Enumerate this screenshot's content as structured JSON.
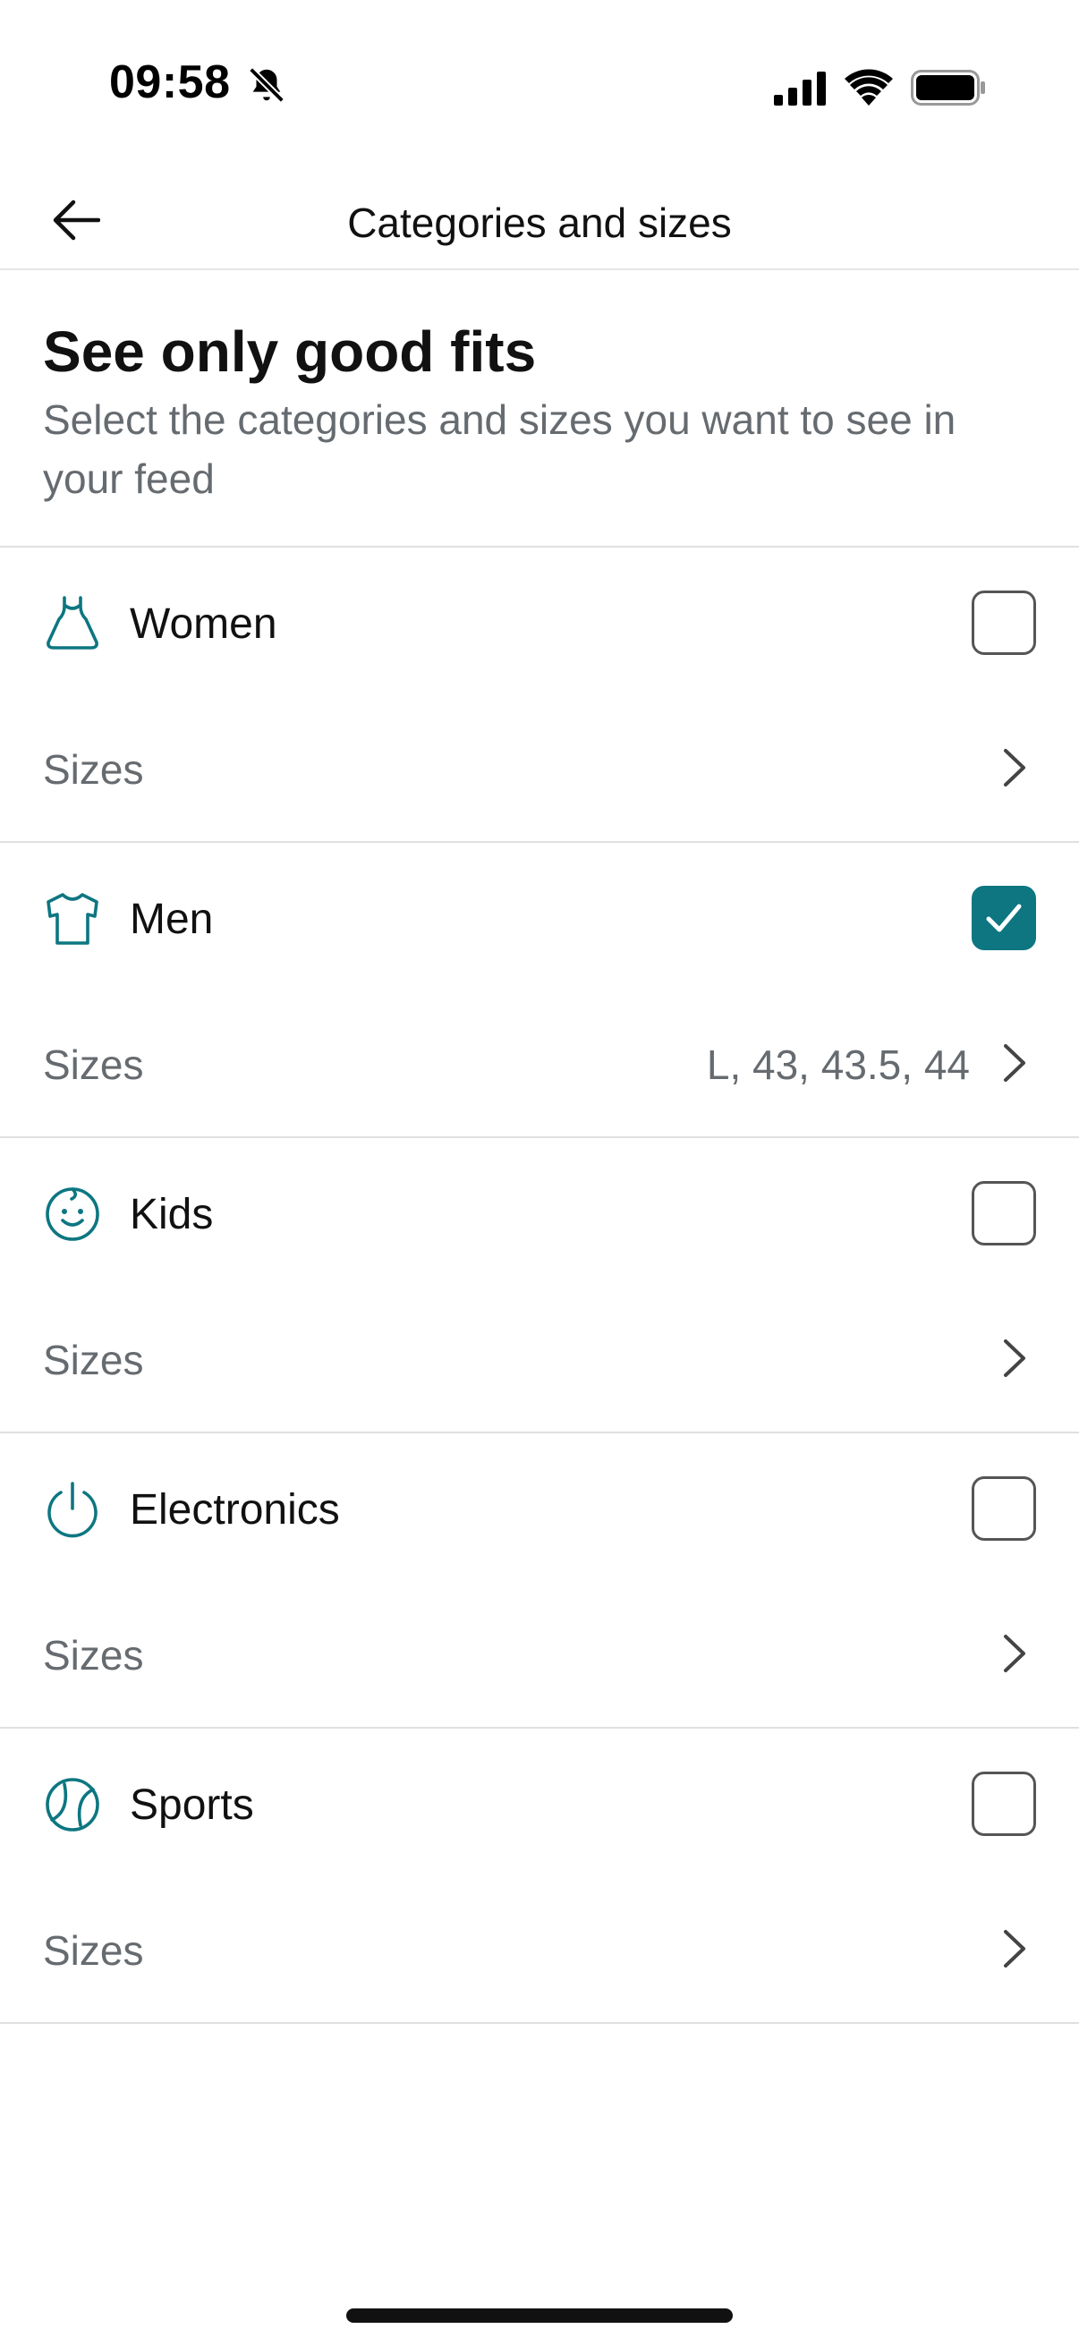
{
  "status_bar": {
    "time": "09:58"
  },
  "header": {
    "title": "Categories and sizes"
  },
  "intro": {
    "title": "See only good fits",
    "subtitle": "Select the categories and sizes you want to see in your feed"
  },
  "accent_color": "#0d7681",
  "categories": [
    {
      "label": "Women",
      "icon": "dress-icon",
      "checked": false,
      "sizes_label": "Sizes",
      "sizes_value": ""
    },
    {
      "label": "Men",
      "icon": "tshirt-icon",
      "checked": true,
      "sizes_label": "Sizes",
      "sizes_value": "L, 43, 43.5, 44"
    },
    {
      "label": "Kids",
      "icon": "baby-face-icon",
      "checked": false,
      "sizes_label": "Sizes",
      "sizes_value": ""
    },
    {
      "label": "Electronics",
      "icon": "power-icon",
      "checked": false,
      "sizes_label": "Sizes",
      "sizes_value": ""
    },
    {
      "label": "Sports",
      "icon": "tennis-ball-icon",
      "checked": false,
      "sizes_label": "Sizes",
      "sizes_value": ""
    }
  ]
}
